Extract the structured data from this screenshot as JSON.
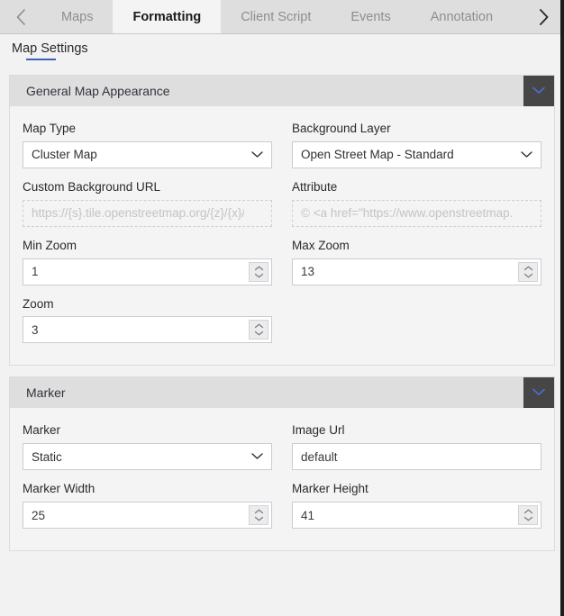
{
  "tabbar": {
    "prev_label": "chevron-left",
    "next_label": "chevron-right",
    "tabs": [
      {
        "label": "Maps",
        "active": false
      },
      {
        "label": "Formatting",
        "active": true
      },
      {
        "label": "Client Script",
        "active": false
      },
      {
        "label": "Events",
        "active": false
      },
      {
        "label": "Annotation",
        "active": false
      }
    ]
  },
  "subheader": {
    "title": "Map Settings",
    "accent_color": "#3e5fbe"
  },
  "panels": [
    {
      "title": "General Map Appearance",
      "collapse_icon": "chevron-down-icon",
      "fields": {
        "map_type": {
          "label": "Map Type",
          "value": "Cluster Map",
          "icon": "chevron-down-icon"
        },
        "background_layer": {
          "label": "Background Layer",
          "value": "Open Street Map - Standard",
          "icon": "chevron-down-icon"
        },
        "custom_background_url": {
          "label": "Custom Background URL",
          "value": "",
          "placeholder": "https://{s}.tile.openstreetmap.org/{z}/{x}/{y}.png"
        },
        "attribute": {
          "label": "Attribute",
          "value": "",
          "placeholder": "© <a href=\"https://www.openstreetmap.org/copyright\">OpenStreetMap</a>"
        },
        "min_zoom": {
          "label": "Min Zoom",
          "value": "1"
        },
        "max_zoom": {
          "label": "Max Zoom",
          "value": "13"
        },
        "zoom": {
          "label": "Zoom",
          "value": "3"
        }
      }
    },
    {
      "title": "Marker",
      "collapse_icon": "chevron-down-icon",
      "fields": {
        "marker": {
          "label": "Marker",
          "value": "Static",
          "icon": "chevron-down-icon"
        },
        "image_url": {
          "label": "Image Url",
          "value": "default",
          "placeholder": ""
        },
        "marker_width": {
          "label": "Marker Width",
          "value": "25"
        },
        "marker_height": {
          "label": "Marker Height",
          "value": "41"
        }
      }
    }
  ],
  "colors": {
    "accent": "#3e5fbe",
    "panel_header_bg": "#dedede",
    "toggle_bg": "#464646",
    "page_bg": "#f2f2f2"
  }
}
